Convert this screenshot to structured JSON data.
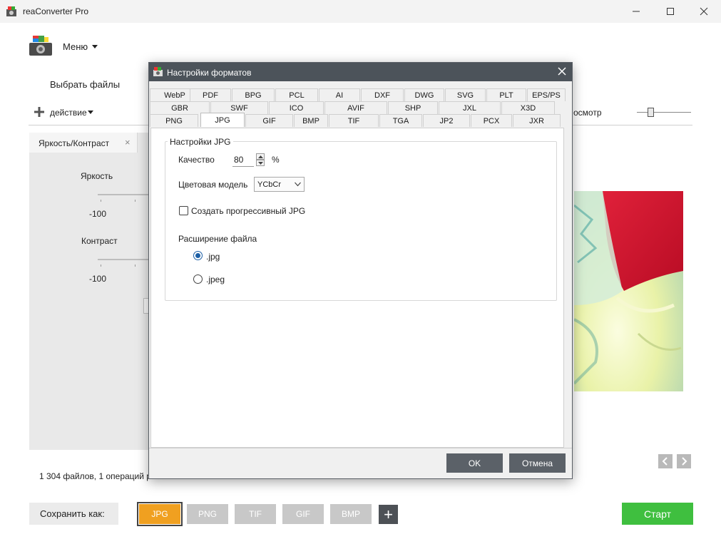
{
  "window": {
    "title": "reaConverter Pro"
  },
  "menu": {
    "label": "Меню"
  },
  "toolbar": {
    "choose_files": "Выбрать файлы",
    "action": "действие",
    "preview": "осмотр"
  },
  "left_panel": {
    "tab_label": "Яркость/Контраст",
    "close": "×",
    "brightness": "Яркость",
    "brightness_min": "-100",
    "contrast": "Контраст",
    "contrast_min": "-100"
  },
  "status": {
    "text": "1 304 файлов,  1 операций р"
  },
  "save_as": {
    "label": "Сохранить как:"
  },
  "formats": [
    {
      "label": "JPG",
      "active": true
    },
    {
      "label": "PNG",
      "active": false
    },
    {
      "label": "TIF",
      "active": false
    },
    {
      "label": "GIF",
      "active": false
    },
    {
      "label": "BMP",
      "active": false
    }
  ],
  "add_format": "+",
  "start": {
    "label": "Старт",
    "color": "#3fbf3f"
  },
  "dialog": {
    "title": "Настройки форматов",
    "tab_rows": [
      [
        "WebP",
        "PDF",
        "BPG",
        "PCL",
        "AI",
        "DXF",
        "DWG",
        "SVG",
        "PLT",
        "EPS/PS"
      ],
      [
        "GBR",
        "SWF",
        "ICO",
        "AVIF",
        "SHP",
        "JXL",
        "X3D"
      ],
      [
        "PNG",
        "JPG",
        "GIF",
        "BMP",
        "TIF",
        "TGA",
        "JP2",
        "PCX",
        "JXR"
      ]
    ],
    "active_tab": "JPG",
    "group_title": "Настройки JPG",
    "quality": {
      "label": "Качество",
      "value": "80",
      "unit": "%"
    },
    "color_model": {
      "label": "Цветовая модель",
      "value": "YCbCr"
    },
    "progressive": {
      "label": "Создать прогрессивный JPG",
      "checked": false
    },
    "extension": {
      "label": "Расширение файла",
      "options": [
        {
          "label": ".jpg",
          "checked": true
        },
        {
          "label": ".jpeg",
          "checked": false
        }
      ]
    },
    "ok": "OK",
    "cancel": "Отмена"
  },
  "colors": {
    "accent": "#f0a020",
    "dialog_title_bg": "#4c535a",
    "button_dark": "#5b6168"
  }
}
